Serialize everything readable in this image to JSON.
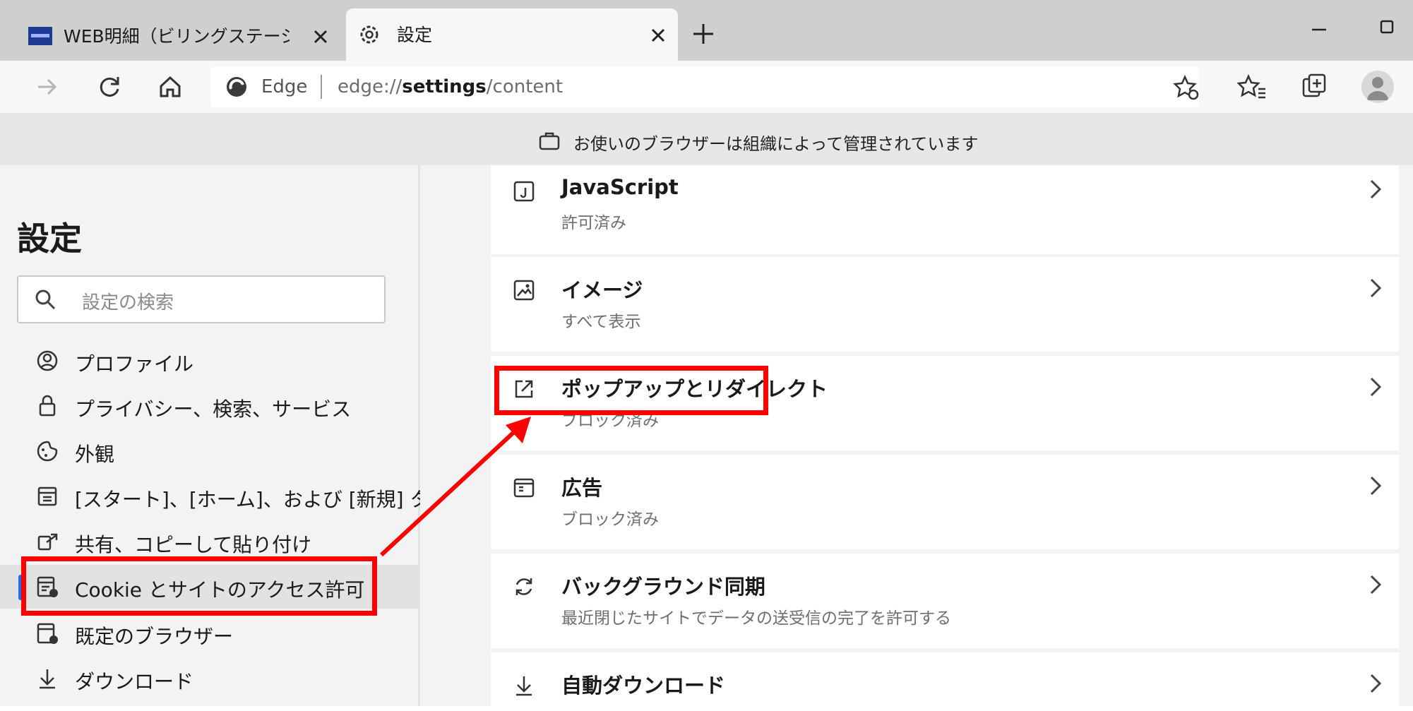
{
  "tabs": [
    {
      "title": "WEB明細（ビリングステーション）| ",
      "active": false
    },
    {
      "title": "設定",
      "active": true
    }
  ],
  "toolbar": {
    "site_label": "Edge",
    "url_prefix": "edge://",
    "url_bold": "settings",
    "url_suffix": "/content"
  },
  "banner": {
    "text": "お使いのブラウザーは組織によって管理されています"
  },
  "sidebar": {
    "title": "設定",
    "search_placeholder": "設定の検索",
    "items": [
      {
        "label": "プロファイル",
        "icon": "profile-icon"
      },
      {
        "label": "プライバシー、検索、サービス",
        "icon": "lock-icon"
      },
      {
        "label": "外観",
        "icon": "appearance-icon"
      },
      {
        "label": "[スタート]、[ホーム]、および [新規] タブ",
        "icon": "home-tab-icon"
      },
      {
        "label": "共有、コピーして貼り付け",
        "icon": "share-icon"
      },
      {
        "label": "Cookie とサイトのアクセス許可",
        "icon": "cookie-site-icon",
        "active": true
      },
      {
        "label": "既定のブラウザー",
        "icon": "default-browser-icon"
      },
      {
        "label": "ダウンロード",
        "icon": "download-icon"
      }
    ]
  },
  "content": {
    "items": [
      {
        "title": "JavaScript",
        "subtitle": "許可済み",
        "icon": "javascript-icon"
      },
      {
        "title": "イメージ",
        "subtitle": "すべて表示",
        "icon": "image-icon"
      },
      {
        "title": "ポップアップとリダイレクト",
        "subtitle": "ブロック済み",
        "icon": "popup-icon"
      },
      {
        "title": "広告",
        "subtitle": "ブロック済み",
        "icon": "ads-icon"
      },
      {
        "title": "バックグラウンド同期",
        "subtitle": "最近閉じたサイトでデータの送受信の完了を許可する",
        "icon": "sync-icon"
      },
      {
        "title": "自動ダウンロード",
        "subtitle": "",
        "icon": "download-icon"
      }
    ]
  },
  "colors": {
    "annotation": "#ff0000",
    "accent": "#1a73e8"
  }
}
